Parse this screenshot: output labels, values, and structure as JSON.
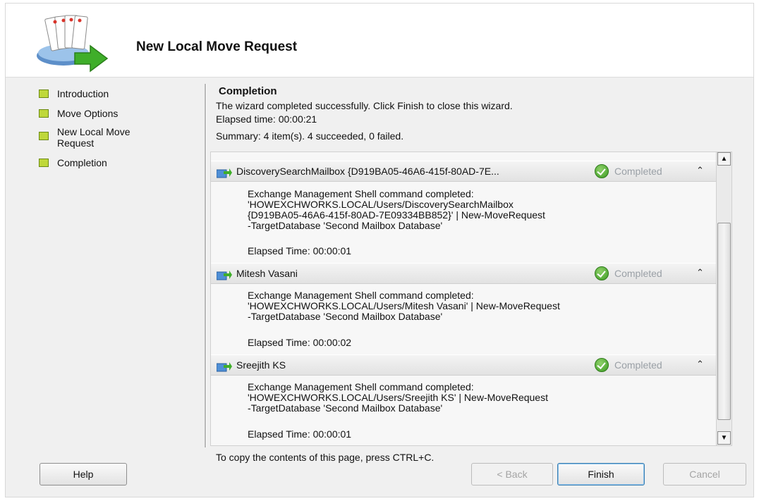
{
  "window": {
    "title": "New Local Move Request"
  },
  "nav": {
    "items": [
      {
        "label": "Introduction"
      },
      {
        "label": "Move Options"
      },
      {
        "label": "New Local Move Request"
      },
      {
        "label": "Completion"
      }
    ]
  },
  "completion": {
    "heading": "Completion",
    "message": "The wizard completed successfully. Click Finish to close this wizard.",
    "elapsed": "Elapsed time: 00:00:21",
    "summary": "Summary: 4 item(s). 4 succeeded, 0 failed."
  },
  "results": [
    {
      "name": "DiscoverySearchMailbox {D919BA05-46A6-415f-80AD-7E...",
      "status": "Completed",
      "lines": [
        "Exchange Management Shell command completed:",
        "'HOWEXCHWORKS.LOCAL/Users/DiscoverySearchMailbox",
        "{D919BA05-46A6-415f-80AD-7E09334BB852}' | New-MoveRequest",
        "-TargetDatabase 'Second Mailbox Database'"
      ],
      "elapsed": "Elapsed Time: 00:00:01"
    },
    {
      "name": "Mitesh Vasani",
      "status": "Completed",
      "lines": [
        "Exchange Management Shell command completed:",
        "'HOWEXCHWORKS.LOCAL/Users/Mitesh Vasani' | New-MoveRequest",
        "-TargetDatabase 'Second Mailbox Database'"
      ],
      "elapsed": "Elapsed Time: 00:00:02"
    },
    {
      "name": "Sreejith KS",
      "status": "Completed",
      "lines": [
        "Exchange Management Shell command completed:",
        "'HOWEXCHWORKS.LOCAL/Users/Sreejith KS' | New-MoveRequest",
        "-TargetDatabase 'Second Mailbox Database'"
      ],
      "elapsed": "Elapsed Time: 00:00:01"
    }
  ],
  "copy_hint": "To copy the contents of this page, press CTRL+C.",
  "buttons": {
    "help": "Help",
    "back": "< Back",
    "finish": "Finish",
    "cancel": "Cancel"
  },
  "icons": {
    "wizard": "move-request-wizard-icon",
    "mailbox": "mailbox-icon",
    "status": "check-circle-icon",
    "collapse": "double-chevron-up-icon"
  },
  "colors": {
    "nav_marker": "#bfd83a",
    "status_ok": "#3b9a22",
    "status_text": "#9aa0a6",
    "accent_button": "#3c7fb1"
  }
}
